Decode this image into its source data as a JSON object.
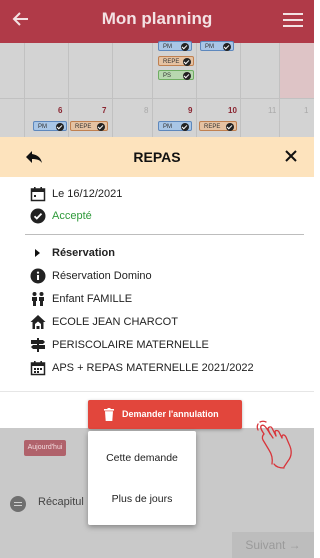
{
  "app": {
    "title": "Mon planning"
  },
  "calendar": {
    "days": [
      "6",
      "7",
      "8",
      "9",
      "10",
      "11",
      "1"
    ],
    "tags_upper": [
      "PM",
      "PM",
      "REPE",
      "PS"
    ],
    "tags_lower": [
      "PM",
      "REPE",
      "PM",
      "REPE"
    ]
  },
  "modal": {
    "title": "REPAS",
    "date": "Le 16/12/2021",
    "status": "Accepté",
    "reservation_heading": "Réservation",
    "items": [
      {
        "icon": "info-icon",
        "label": "Réservation Domino"
      },
      {
        "icon": "family-icon",
        "label": "Enfant FAMILLE"
      },
      {
        "icon": "school-icon",
        "label": "ECOLE JEAN CHARCOT"
      },
      {
        "icon": "signpost-icon",
        "label": "PERISCOLAIRE MATERNELLE"
      },
      {
        "icon": "calendar-icon",
        "label": "APS + REPAS MATERNELLE 2021/2022"
      }
    ],
    "cancel_button": "Demander l'annulation"
  },
  "dropdown": {
    "options": [
      "Cette demande",
      "Plus de jours"
    ]
  },
  "background": {
    "today_label": "Aujourd'hui",
    "recap_label": "Récapitul",
    "next_label": "Suivant →"
  },
  "colors": {
    "topbar": "#b03a48",
    "modal_header": "#fde3bd",
    "accepted": "#2e9a3a",
    "cancel_button": "#e2463c"
  }
}
